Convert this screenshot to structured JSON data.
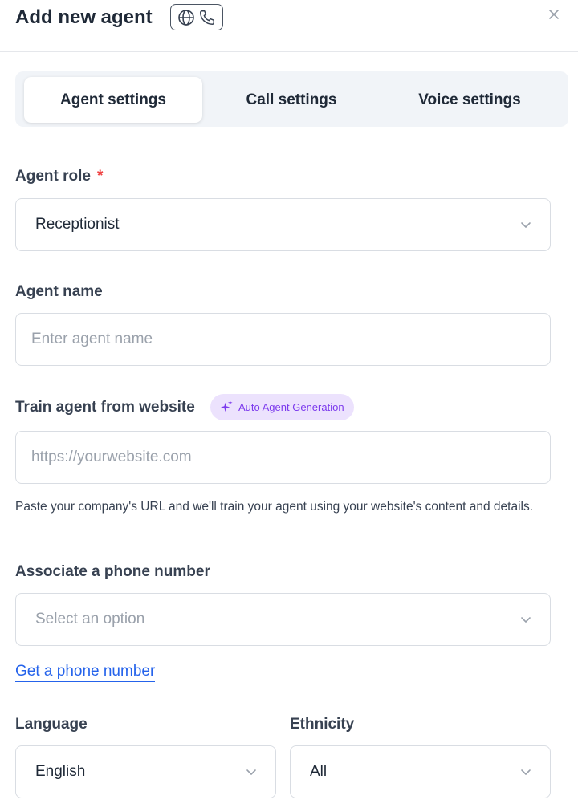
{
  "header": {
    "title": "Add new agent",
    "channel_icons": [
      "globe-icon",
      "phone-icon"
    ],
    "close_icon": "close-icon"
  },
  "tabs": [
    {
      "label": "Agent settings",
      "active": true
    },
    {
      "label": "Call settings",
      "active": false
    },
    {
      "label": "Voice settings",
      "active": false
    }
  ],
  "form": {
    "agent_role": {
      "label": "Agent role",
      "required_mark": "*",
      "value": "Receptionist"
    },
    "agent_name": {
      "label": "Agent name",
      "placeholder": "Enter agent name"
    },
    "website": {
      "label": "Train agent from website",
      "badge": "Auto Agent Generation",
      "placeholder": "https://yourwebsite.com",
      "help": "Paste your company's URL and we'll train your agent using your website's content and details."
    },
    "phone": {
      "label": "Associate a phone number",
      "placeholder": "Select an option",
      "link": "Get a phone number"
    },
    "language": {
      "label": "Language",
      "value": "English"
    },
    "ethnicity": {
      "label": "Ethnicity",
      "value": "All"
    }
  },
  "colors": {
    "accent": "#2563eb",
    "required": "#ef4444",
    "badge_bg": "#ece2fd",
    "badge_text": "#7c3aed",
    "tabs_bg": "#f1f4f8"
  }
}
